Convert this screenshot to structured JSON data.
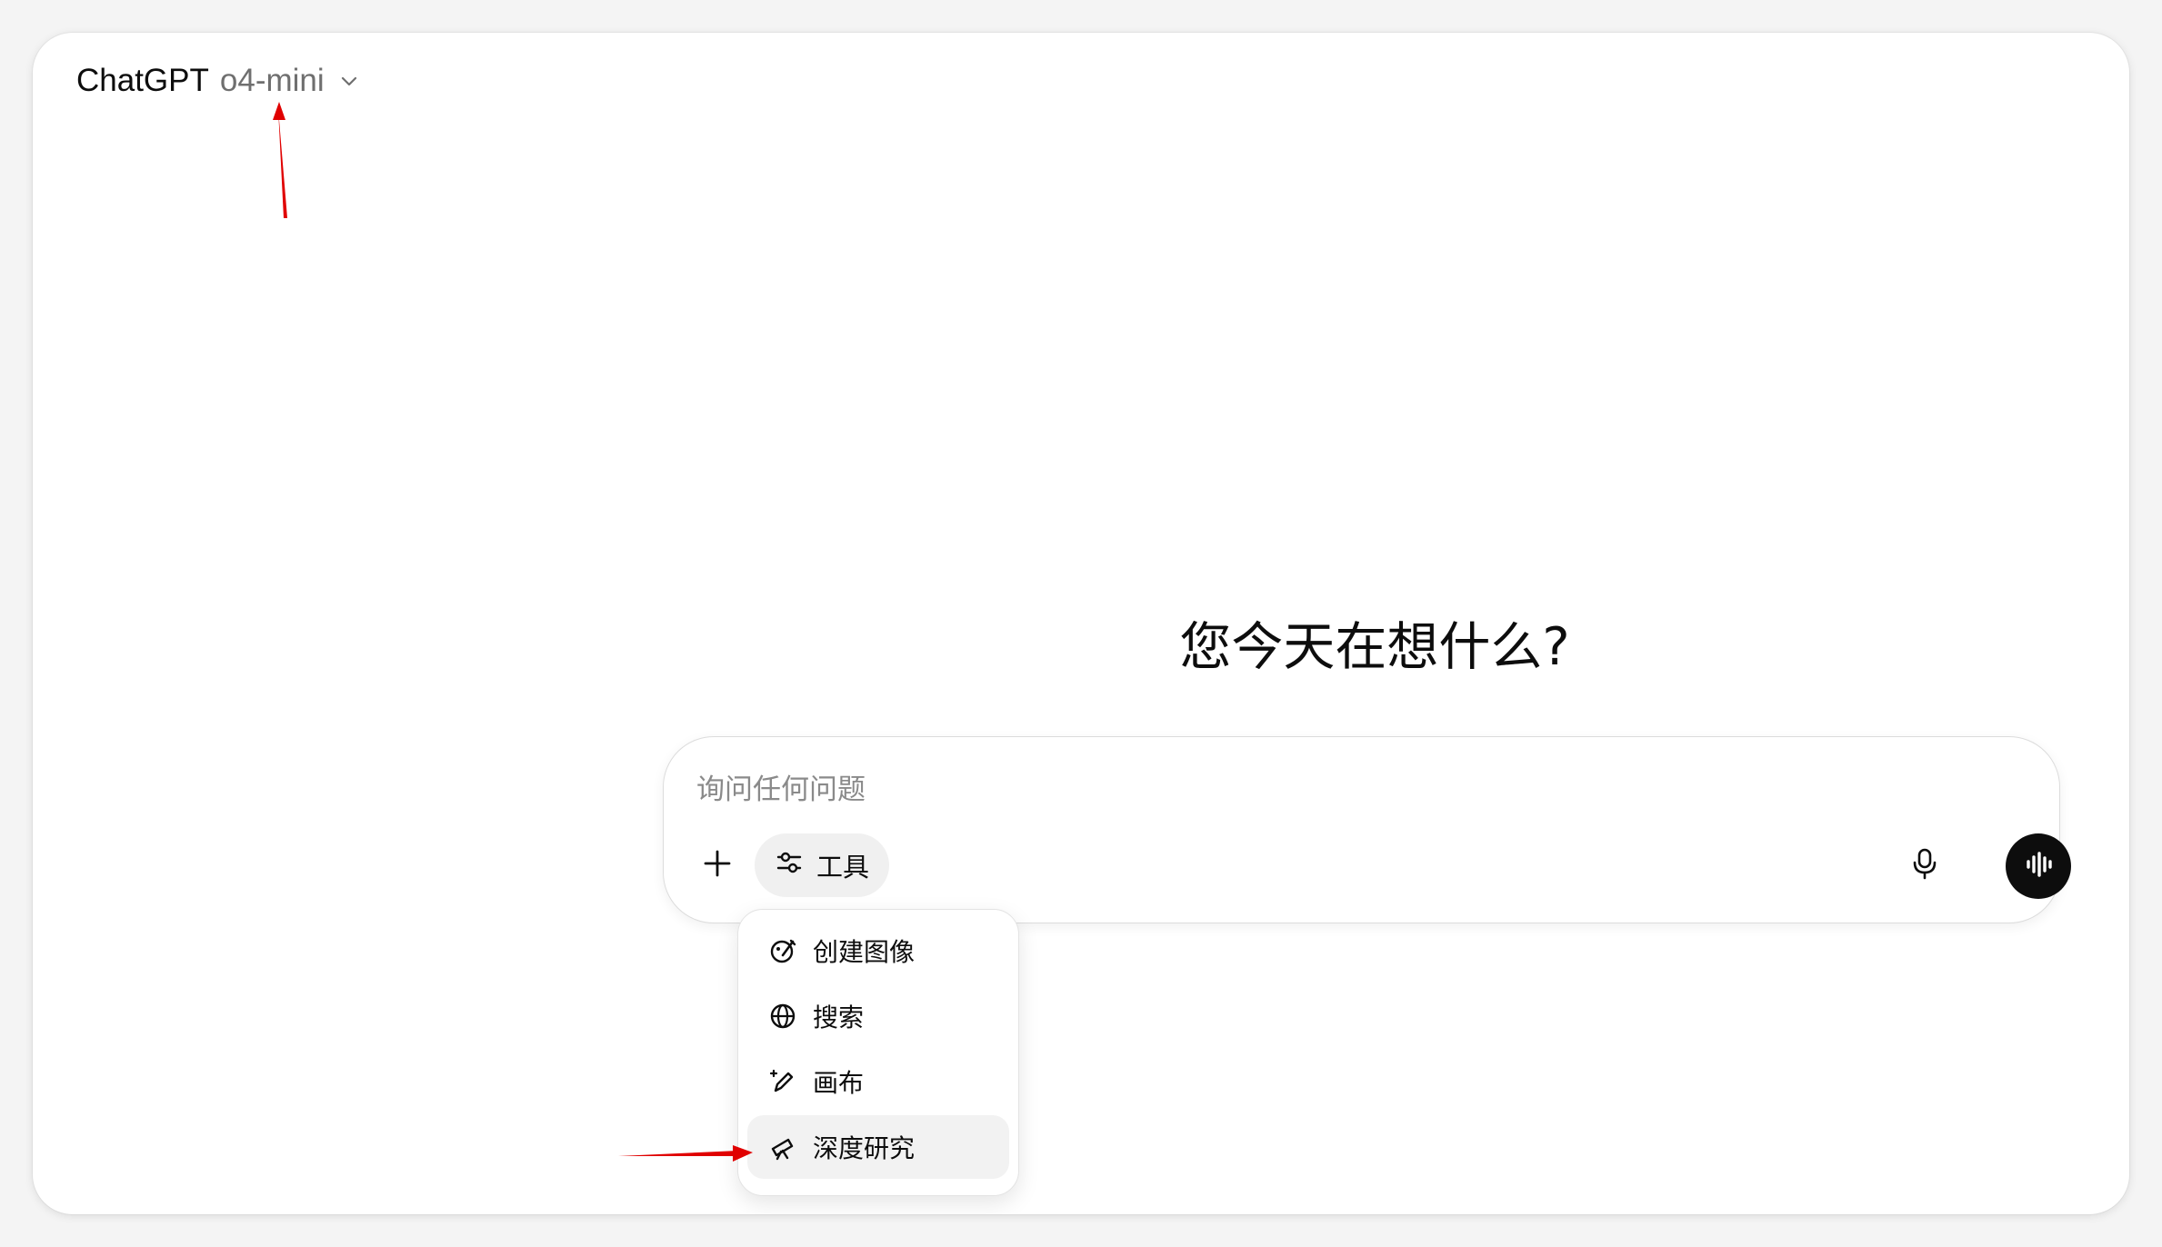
{
  "header": {
    "app_name": "ChatGPT",
    "model_name": "o4-mini"
  },
  "main": {
    "headline": "您今天在想什么?"
  },
  "composer": {
    "placeholder": "询问任何问题",
    "tools_label": "工具"
  },
  "tools_menu": {
    "items": [
      {
        "label": "创建图像",
        "icon": "image-create-icon"
      },
      {
        "label": "搜索",
        "icon": "globe-icon"
      },
      {
        "label": "画布",
        "icon": "canvas-pen-icon"
      },
      {
        "label": "深度研究",
        "icon": "telescope-icon"
      }
    ]
  },
  "colors": {
    "annotation_arrow": "#e00000",
    "voice_button": "#0d0d0d",
    "hover_item": "#f2f2f2"
  }
}
